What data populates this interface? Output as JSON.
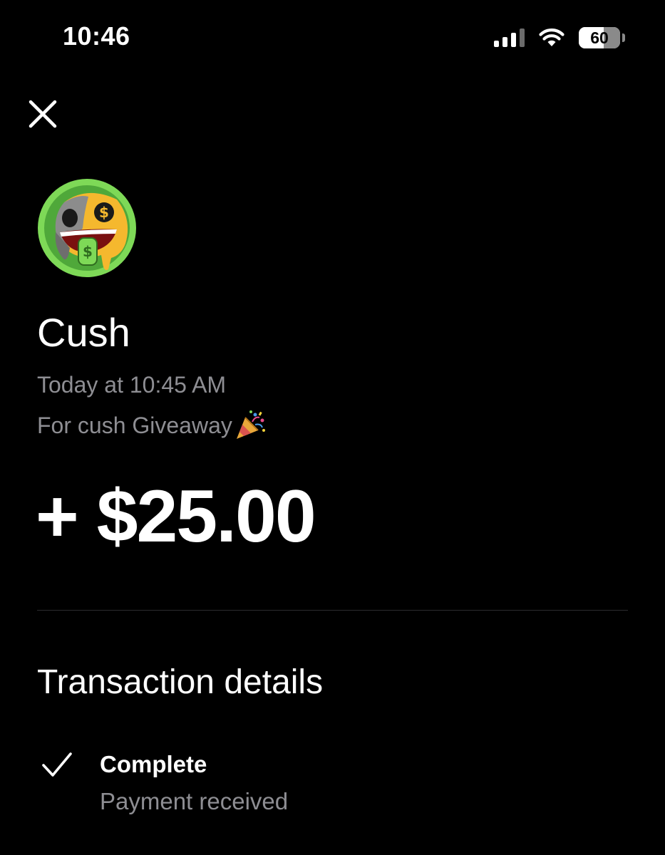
{
  "status_bar": {
    "time": "10:46",
    "battery": "60",
    "battery_level_percent": 60,
    "icons": [
      "cellular-signal-icon",
      "wifi-icon",
      "battery-icon"
    ]
  },
  "header": {
    "close_icon": "close-icon"
  },
  "transaction": {
    "avatar_icon": "melting-skull-dollar-avatar",
    "name": "Cush",
    "timestamp": "Today at 10:45 AM",
    "note": "For cush Giveaway",
    "note_emoji_icon": "party-popper-icon",
    "amount": "+ $25.00"
  },
  "details": {
    "title": "Transaction details",
    "status_icon": "checkmark-icon",
    "status": "Complete",
    "status_description": "Payment received"
  },
  "colors": {
    "background": "#000000",
    "primary_text": "#ffffff",
    "secondary_text": "#8e8e93",
    "divider": "#2c2c2e",
    "avatar_ring": "#7ed957"
  }
}
